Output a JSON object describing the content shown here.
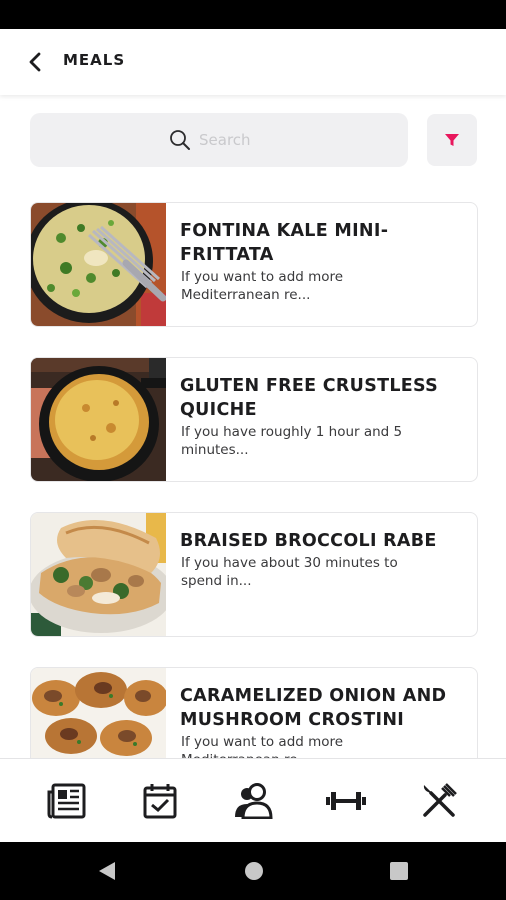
{
  "header": {
    "title": "MEALS"
  },
  "search": {
    "placeholder": "Search",
    "value": ""
  },
  "accent_color": "#e8175d",
  "meals": [
    {
      "title": "FONTINA KALE MINI-FRITTATA",
      "description": "If you want to add more Mediterranean re..."
    },
    {
      "title": "GLUTEN FREE CRUSTLESS QUICHE",
      "description": "If you have roughly 1 hour and 5 minutes..."
    },
    {
      "title": "BRAISED BROCCOLI RABE",
      "description": "If you have about 30 minutes to spend in..."
    },
    {
      "title": "CARAMELIZED ONION AND MUSHROOM CROSTINI",
      "description": "If you want to add more Mediterranean re..."
    }
  ],
  "bottom_nav": {
    "items": [
      {
        "icon": "newspaper-icon"
      },
      {
        "icon": "calendar-check-icon"
      },
      {
        "icon": "users-icon"
      },
      {
        "icon": "dumbbell-icon"
      },
      {
        "icon": "fork-knife-icon"
      }
    ]
  },
  "system_nav": {
    "icons": [
      "back-triangle-icon",
      "home-circle-icon",
      "recents-square-icon"
    ]
  }
}
